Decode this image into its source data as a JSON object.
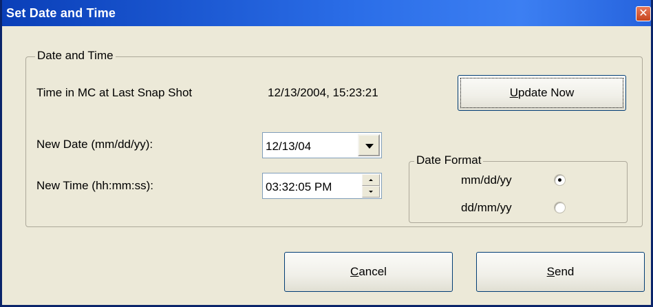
{
  "window": {
    "title": "Set Date and Time",
    "close_glyph": "✕"
  },
  "group_datetime": {
    "legend": "Date and Time",
    "last_snapshot_label": "Time in MC at Last Snap Shot",
    "last_snapshot_value": "12/13/2004, 15:23:21",
    "update_button": {
      "mnemonic": "U",
      "rest": "pdate Now"
    },
    "new_date_label": "New Date (mm/dd/yy):",
    "new_date_value": "12/13/04",
    "new_time_label": "New Time (hh:mm:ss):",
    "new_time_value": "03:32:05 PM"
  },
  "group_date_format": {
    "legend": "Date Format",
    "options": [
      {
        "label": "mm/dd/yy",
        "selected": true
      },
      {
        "label": "dd/mm/yy",
        "selected": false
      }
    ]
  },
  "buttons": {
    "cancel": {
      "mnemonic": "C",
      "rest": "ancel"
    },
    "send": {
      "mnemonic": "S",
      "rest": "end"
    }
  },
  "icons": {
    "close": "close-icon",
    "dropdown": "chevron-down-icon",
    "spin_up": "spin-up-icon",
    "spin_down": "spin-down-icon"
  },
  "colors": {
    "titlebar": "#0a3fb8",
    "dialog_bg": "#ece9d8",
    "close_button": "#c6441c"
  }
}
